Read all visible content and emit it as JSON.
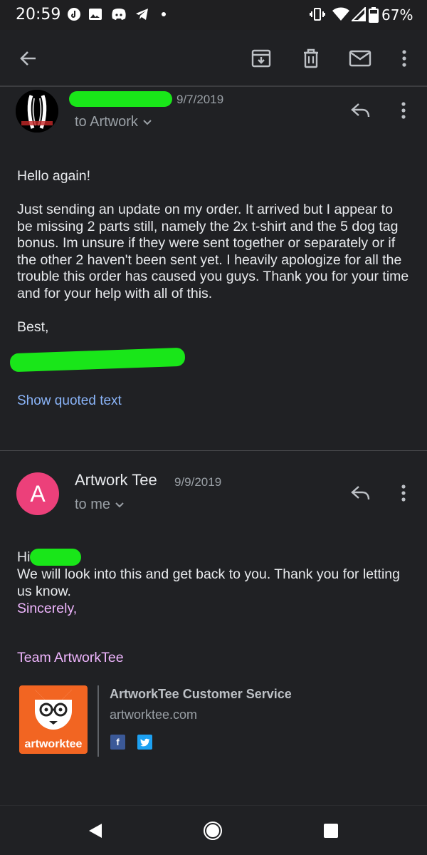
{
  "status_bar": {
    "time": "20:59",
    "battery": "67%",
    "icons": [
      "tiktok-icon",
      "image-icon",
      "discord-icon",
      "telegram-icon",
      "dot-icon",
      "vibrate-icon",
      "wifi-icon",
      "signal-icon",
      "battery-icon"
    ]
  },
  "toolbar": {
    "icons": [
      "back-arrow-icon",
      "archive-icon",
      "delete-icon",
      "mail-icon",
      "more-vert-icon"
    ]
  },
  "message1": {
    "date": "9/7/2019",
    "to": "to Artwork",
    "body": "Hello again!\n\nJust sending an update on my order. It arrived but I appear to be missing 2 parts still, namely the 2x t-shirt and the 5 dog tag bonus. Im unsure if they were sent together or separately or if the other 2 haven't been sent yet. I heavily apologize for all the trouble this order has caused you guys. Thank you for your time and for your help with all of this.\n\nBest,",
    "show_quoted": "Show quoted text"
  },
  "message2": {
    "avatar_letter": "A",
    "sender": "Artwork Tee",
    "date": "9/9/2019",
    "to": "to me",
    "greeting": "Hi",
    "line1": "We will look into this and get back to you. Thank you for letting us know.",
    "closing": "Sincerely,",
    "team": "Team ArtworkTee",
    "signature": {
      "logo_text": "artworktee",
      "name": "ArtworkTee Customer Service",
      "site": "artworktee.com",
      "social": [
        "facebook-icon",
        "twitter-icon"
      ],
      "facebook_glyph": "f"
    }
  },
  "colors": {
    "background": "#202124",
    "link": "#8ab4f8",
    "purple_text": "#f0b6ff",
    "avatar_pink": "#ec407a",
    "redaction_green": "#19e619",
    "logo_orange": "#f26522",
    "facebook_blue": "#3b5998",
    "twitter_blue": "#1da1f2"
  }
}
